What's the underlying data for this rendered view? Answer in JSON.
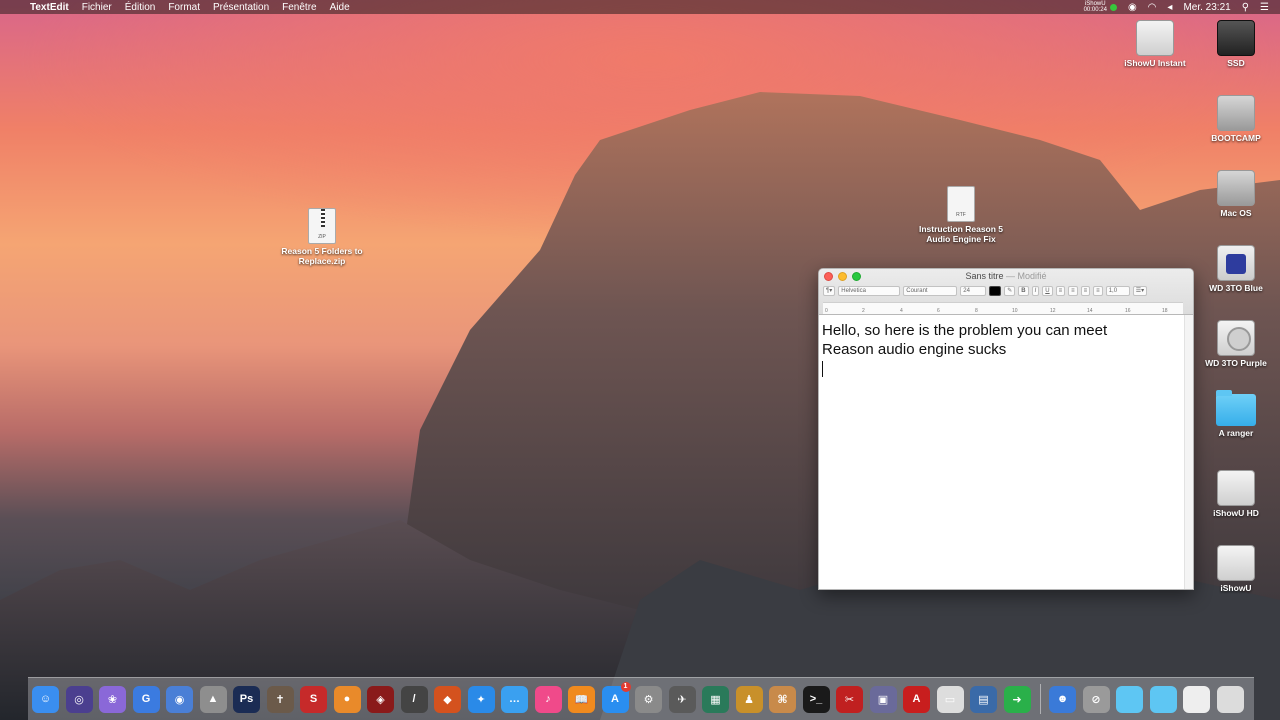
{
  "menubar": {
    "app_name": "TextEdit",
    "menus": [
      "Fichier",
      "Édition",
      "Format",
      "Présentation",
      "Fenêtre",
      "Aide"
    ],
    "ishowu_label": "iShowU",
    "ishowu_time": "00:00:24",
    "clock": "Mer. 23:21"
  },
  "desktop": {
    "zip_file": {
      "badge": "ZIP",
      "label": "Reason 5 Folders to Replace.zip"
    },
    "rtf_file": {
      "badge": "RTF",
      "label": "Instruction Reason 5 Audio Engine Fix"
    },
    "volumes": [
      {
        "label": "iShowU Instant"
      },
      {
        "label": "SSD"
      },
      {
        "label": "BOOTCAMP"
      },
      {
        "label": "Mac OS"
      },
      {
        "label": "WD 3TO Blue"
      },
      {
        "label": "WD 3TO Purple"
      },
      {
        "label": "A ranger"
      },
      {
        "label": "iShowU HD"
      },
      {
        "label": "iShowU"
      }
    ]
  },
  "textedit": {
    "title": "Sans titre",
    "status": "— Modifié",
    "font_family": "Helvetica",
    "font_style": "Courant",
    "font_size": "24",
    "bold": "B",
    "italic": "I",
    "underline": "U",
    "line_spacing": "1,0",
    "ruler_numbers": [
      "0",
      "2",
      "4",
      "6",
      "8",
      "10",
      "12",
      "14",
      "16",
      "18"
    ],
    "lines": [
      "Hello, so here is the problem you can meet",
      "Reason audio engine sucks"
    ]
  },
  "dock": {
    "apps": [
      {
        "icon": "finder-icon",
        "color": "#3a8ef0",
        "glyph": "☺"
      },
      {
        "icon": "siri-icon",
        "color": "#4b3f8f",
        "glyph": "◎"
      },
      {
        "icon": "app-icon",
        "color": "#8a68d8",
        "glyph": "❀"
      },
      {
        "icon": "app-icon",
        "color": "#3b7be0",
        "glyph": "G"
      },
      {
        "icon": "app-icon",
        "color": "#4a7fd6",
        "glyph": "◉"
      },
      {
        "icon": "app-icon",
        "color": "#8e8e8e",
        "glyph": "▲"
      },
      {
        "icon": "photoshop-icon",
        "color": "#1b2c54",
        "glyph": "Ps"
      },
      {
        "icon": "app-icon",
        "color": "#6b5a4a",
        "glyph": "✝"
      },
      {
        "icon": "app-icon",
        "color": "#c62a2a",
        "glyph": "S"
      },
      {
        "icon": "blender-icon",
        "color": "#e98a2a",
        "glyph": "●"
      },
      {
        "icon": "app-icon",
        "color": "#8a1a1a",
        "glyph": "◈"
      },
      {
        "icon": "app-icon",
        "color": "#444444",
        "glyph": "/"
      },
      {
        "icon": "app-icon",
        "color": "#d4521e",
        "glyph": "◆"
      },
      {
        "icon": "safari-icon",
        "color": "#2a8ae8",
        "glyph": "✦"
      },
      {
        "icon": "messages-icon",
        "color": "#3aa0f0",
        "glyph": "…"
      },
      {
        "icon": "itunes-icon",
        "color": "#f04a8a",
        "glyph": "♪"
      },
      {
        "icon": "ibooks-icon",
        "color": "#f08a1e",
        "glyph": "📖"
      },
      {
        "icon": "app-store-icon",
        "color": "#2a8ef0",
        "glyph": "A",
        "badge": "1"
      },
      {
        "icon": "system-preferences-icon",
        "color": "#8a8a8a",
        "glyph": "⚙"
      },
      {
        "icon": "app-icon",
        "color": "#5a5a5a",
        "glyph": "✈"
      },
      {
        "icon": "app-icon",
        "color": "#2a7a5a",
        "glyph": "▦"
      },
      {
        "icon": "app-icon",
        "color": "#c8902a",
        "glyph": "♟"
      },
      {
        "icon": "app-icon",
        "color": "#c88a4a",
        "glyph": "⌘"
      },
      {
        "icon": "terminal-icon",
        "color": "#1a1a1a",
        "glyph": ">_"
      },
      {
        "icon": "app-icon",
        "color": "#c02020",
        "glyph": "✂"
      },
      {
        "icon": "app-icon",
        "color": "#6a6a9a",
        "glyph": "▣"
      },
      {
        "icon": "app-icon",
        "color": "#c81e1e",
        "glyph": "A"
      },
      {
        "icon": "app-icon",
        "color": "#dddddd",
        "glyph": "▭"
      },
      {
        "icon": "app-icon",
        "color": "#3a6aa8",
        "glyph": "▤"
      },
      {
        "icon": "app-icon",
        "color": "#2ab04a",
        "glyph": "➜"
      }
    ],
    "others": [
      {
        "icon": "downloads-icon",
        "color": "#3a7ad8",
        "glyph": "☻"
      },
      {
        "icon": "app-icon",
        "color": "#9a9a9a",
        "glyph": "⊘"
      },
      {
        "icon": "folder-icon",
        "color": "#5ec6f3",
        "glyph": ""
      },
      {
        "icon": "folder-icon",
        "color": "#5ec6f3",
        "glyph": ""
      },
      {
        "icon": "document-icon",
        "color": "#eeeeee",
        "glyph": ""
      },
      {
        "icon": "trash-icon",
        "color": "#dcdcdc",
        "glyph": ""
      }
    ]
  }
}
